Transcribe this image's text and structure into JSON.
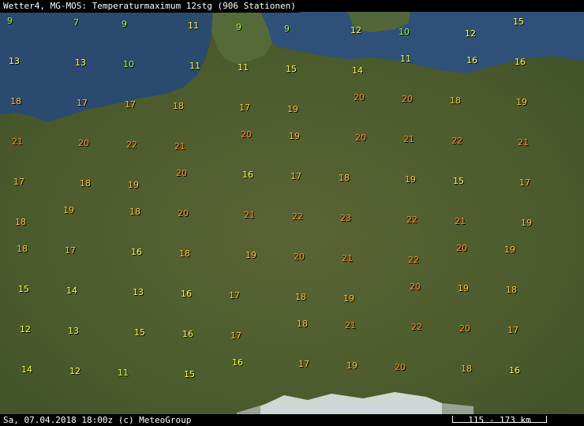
{
  "title": "Wetter4, MG-MOS: Temperaturmaximum 12stg (906 Stationen)",
  "footer": {
    "datetime_credit": "Sa, 07.04.2018 18:00z (c) MeteoGroup",
    "scale": "115 - 173 km"
  },
  "colors": {
    "sea": "#2a4a70",
    "land": "#4a5a2c",
    "alps_snow": "#e8ecef",
    "t_cold": "#9afc3a",
    "t_mild": "#ffff3c",
    "t_warm": "#ffc040",
    "t_hot": "#ff8a2a"
  },
  "stations": [
    {
      "v": 9
    },
    {
      "v": 7
    },
    {
      "v": 9
    },
    {
      "v": 11
    },
    {
      "v": 9
    },
    {
      "v": 9
    },
    {
      "v": 12
    },
    {
      "v": 10
    },
    {
      "v": 12
    },
    {
      "v": 15
    },
    {
      "v": 13
    },
    {
      "v": 13
    },
    {
      "v": 10
    },
    {
      "v": 11
    },
    {
      "v": 11
    },
    {
      "v": 15
    },
    {
      "v": 14
    },
    {
      "v": 11
    },
    {
      "v": 16
    },
    {
      "v": 16
    },
    {
      "v": 18
    },
    {
      "v": 17
    },
    {
      "v": 17
    },
    {
      "v": 18
    },
    {
      "v": 17
    },
    {
      "v": 19
    },
    {
      "v": 20
    },
    {
      "v": 20
    },
    {
      "v": 18
    },
    {
      "v": 19
    },
    {
      "v": 21
    },
    {
      "v": 20
    },
    {
      "v": 22
    },
    {
      "v": 21
    },
    {
      "v": 20
    },
    {
      "v": 19
    },
    {
      "v": 20
    },
    {
      "v": 21
    },
    {
      "v": 22
    },
    {
      "v": 21
    },
    {
      "v": 17
    },
    {
      "v": 18
    },
    {
      "v": 19
    },
    {
      "v": 20
    },
    {
      "v": 16
    },
    {
      "v": 17
    },
    {
      "v": 18
    },
    {
      "v": 19
    },
    {
      "v": 15
    },
    {
      "v": 17
    },
    {
      "v": 18
    },
    {
      "v": 19
    },
    {
      "v": 18
    },
    {
      "v": 20
    },
    {
      "v": 21
    },
    {
      "v": 22
    },
    {
      "v": 23
    },
    {
      "v": 22
    },
    {
      "v": 21
    },
    {
      "v": 19
    },
    {
      "v": 18
    },
    {
      "v": 17
    },
    {
      "v": 16
    },
    {
      "v": 18
    },
    {
      "v": 19
    },
    {
      "v": 20
    },
    {
      "v": 21
    },
    {
      "v": 22
    },
    {
      "v": 20
    },
    {
      "v": 19
    },
    {
      "v": 15
    },
    {
      "v": 14
    },
    {
      "v": 13
    },
    {
      "v": 16
    },
    {
      "v": 17
    },
    {
      "v": 18
    },
    {
      "v": 19
    },
    {
      "v": 20
    },
    {
      "v": 19
    },
    {
      "v": 18
    },
    {
      "v": 12
    },
    {
      "v": 13
    },
    {
      "v": 15
    },
    {
      "v": 16
    },
    {
      "v": 17
    },
    {
      "v": 18
    },
    {
      "v": 21
    },
    {
      "v": 22
    },
    {
      "v": 20
    },
    {
      "v": 17
    },
    {
      "v": 14
    },
    {
      "v": 12
    },
    {
      "v": 11
    },
    {
      "v": 15
    },
    {
      "v": 16
    },
    {
      "v": 17
    },
    {
      "v": 19
    },
    {
      "v": 20
    },
    {
      "v": 18
    },
    {
      "v": 16
    }
  ]
}
